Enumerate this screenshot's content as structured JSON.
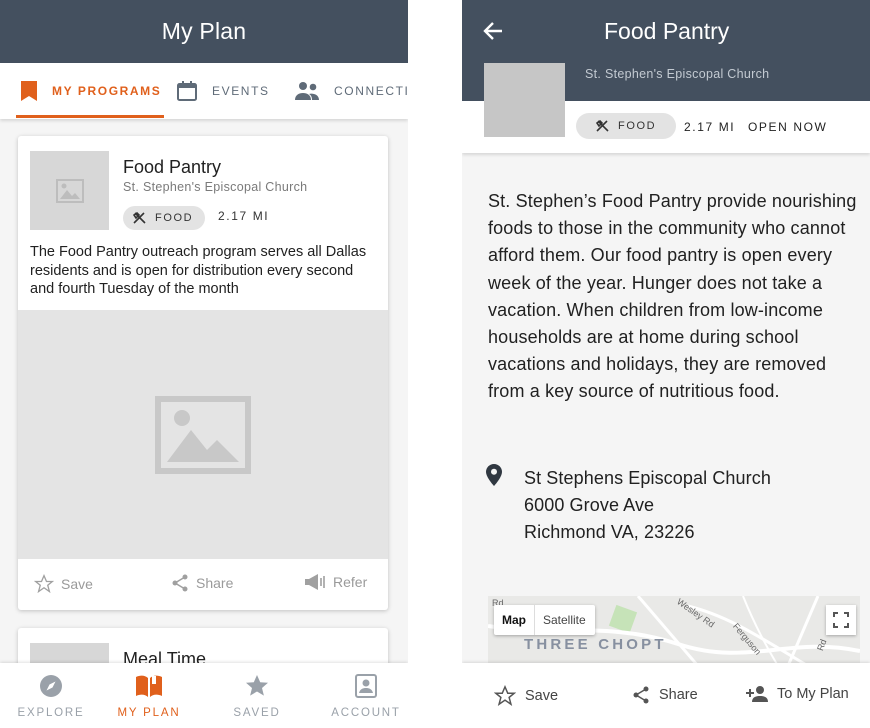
{
  "colors": {
    "appbar": "#44505f",
    "accent": "#e0601c",
    "muted": "#9aa1a9"
  },
  "left": {
    "appbar": {
      "title": "My Plan"
    },
    "tabs": [
      {
        "label": "MY PROGRAMS",
        "icon": "bookmark-icon",
        "active": true
      },
      {
        "label": "EVENTS",
        "icon": "calendar-icon",
        "active": false
      },
      {
        "label": "CONNECTIO",
        "icon": "people-icon",
        "active": false
      }
    ],
    "card": {
      "name": "Food Pantry",
      "org": "St. Stephen's Episcopal Church",
      "category": "FOOD",
      "distance": "2.17 MI",
      "description": "The Food Pantry outreach program serves all Dallas residents and is open for distribution every second and fourth Tuesday of the month",
      "actions": {
        "save": "Save",
        "share": "Share",
        "refer": "Refer"
      }
    },
    "card2": {
      "name": "Meal Time"
    },
    "bottom_nav": [
      {
        "label": "EXPLORE",
        "icon": "compass-icon",
        "active": false
      },
      {
        "label": "MY PLAN",
        "icon": "book-icon",
        "active": true
      },
      {
        "label": "SAVED",
        "icon": "star-icon",
        "active": false
      },
      {
        "label": "ACCOUNT",
        "icon": "account-icon",
        "active": false
      }
    ]
  },
  "right": {
    "appbar": {
      "title": "Food Pantry",
      "org": "St. Stephen's Episcopal Church"
    },
    "info": {
      "category": "FOOD",
      "distance": "2.17 MI",
      "status": "OPEN NOW"
    },
    "description": "St. Stephen’s Food Pantry provide nourishing foods to those in the community who cannot afford them. Our food pantry is open every week of the year. Hunger does not take a vacation. When children from low-income households are at home during school vacations and holidays, they are removed from a key source of nutritious food.",
    "address": {
      "line1": "St Stephens Episcopal Church",
      "line2": "6000 Grove Ave",
      "line3": "Richmond VA, 23226"
    },
    "map": {
      "map_label": "Map",
      "satellite_label": "Satellite",
      "area_label": "THREE CHOPT",
      "streets": [
        "Wesley Rd",
        "Ferguson",
        "Rd",
        "Rd"
      ]
    },
    "actions": {
      "save": "Save",
      "share": "Share",
      "add": "To My Plan"
    }
  }
}
